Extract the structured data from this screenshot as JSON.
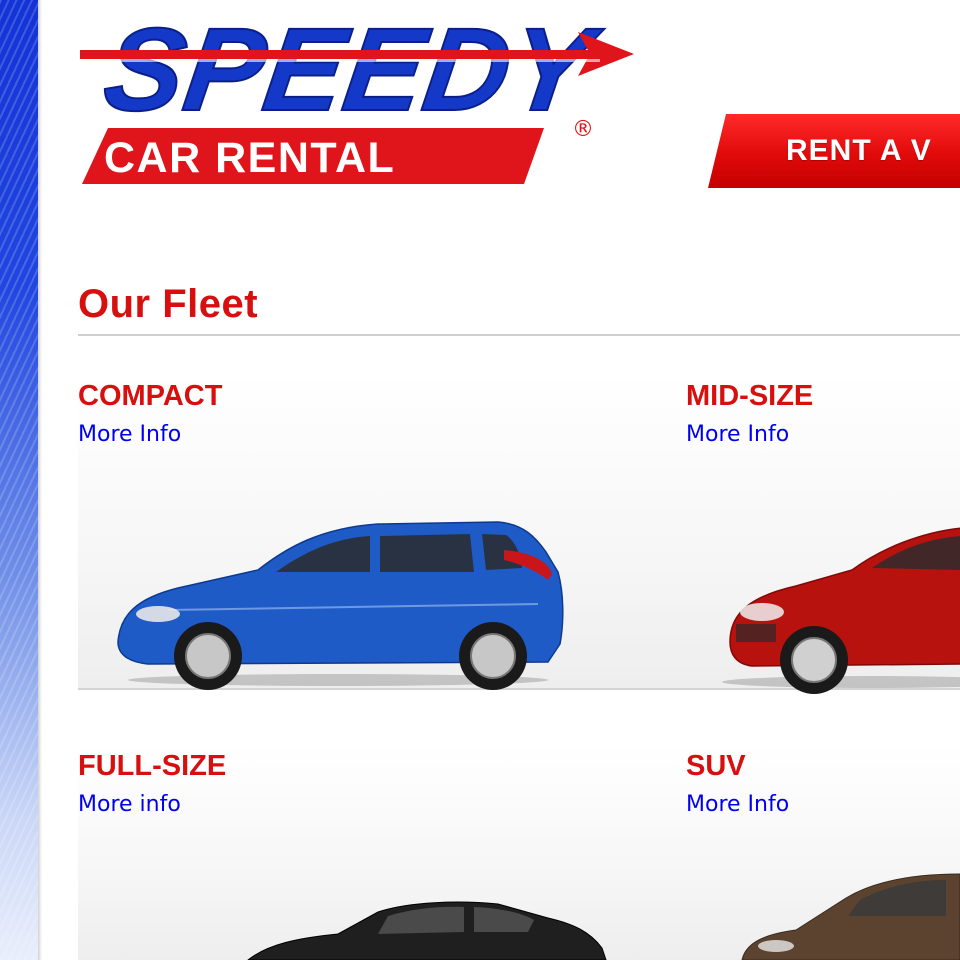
{
  "brand": {
    "logo_top": "SPEEDY",
    "logo_bottom": "CAR RENTAL",
    "registered_mark": "®",
    "blue": "#1438c8",
    "red": "#d70f0f"
  },
  "header": {
    "rent_button_label": "RENT A V"
  },
  "main": {
    "title": "Our Fleet",
    "cards": [
      {
        "title": "COMPACT",
        "link": "More Info",
        "car_color": "#1f5bc7",
        "car": "blue-hatchback-image"
      },
      {
        "title": "MID-SIZE",
        "link": "More Info",
        "car_color": "#b8120f",
        "car": "red-hatchback-image"
      },
      {
        "title": "FULL-SIZE",
        "link": "More info",
        "car_color": "#1f1f1f",
        "car": "black-sedan-image"
      },
      {
        "title": "SUV",
        "link": "More Info",
        "car_color": "#5b4330",
        "car": "brown-suv-image"
      }
    ]
  },
  "colors": {
    "link": "#0000ee",
    "sidebar": "#1333d6"
  }
}
